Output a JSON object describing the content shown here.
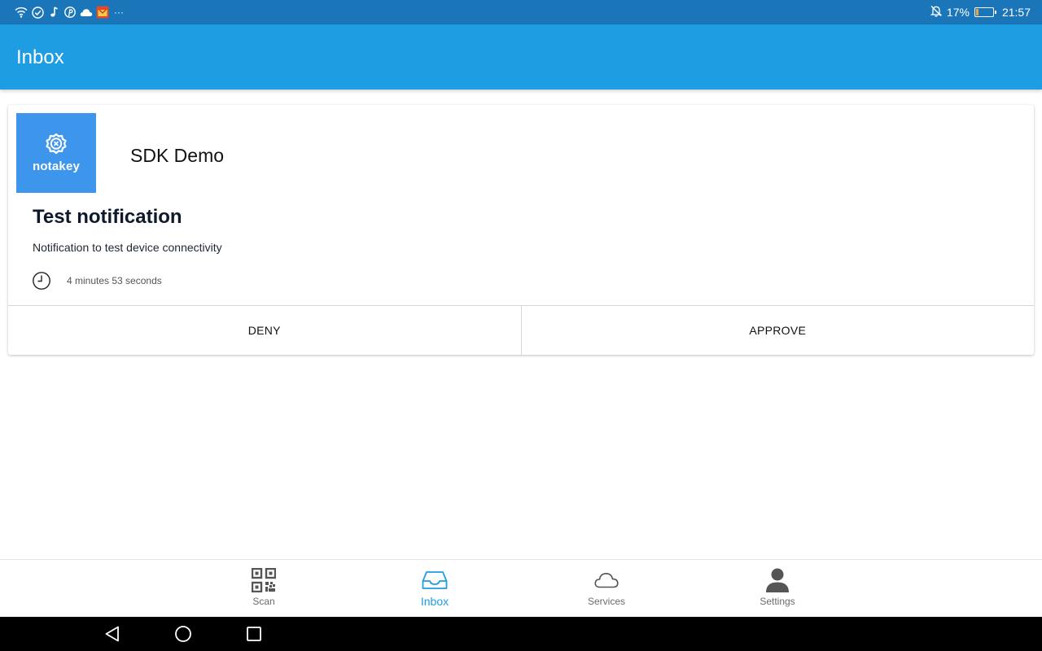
{
  "status_bar": {
    "left_icons": [
      "wifi-icon",
      "check-circle-icon",
      "music-note-icon",
      "pinterest-icon",
      "cloud-icon",
      "app-notification-icon",
      "more-dots-icon"
    ],
    "more_dots": "···",
    "right_icons": [
      "bell-off-icon",
      "battery-icon"
    ],
    "battery_percent": "17%",
    "battery_level": 0.17,
    "time": "21:57",
    "color": "#1a76b8"
  },
  "app_bar": {
    "title": "Inbox",
    "color": "#1f9de3"
  },
  "notification": {
    "logo_text": "notakey",
    "service_name": "SDK Demo",
    "title": "Test notification",
    "body": "Notification to test device connectivity",
    "elapsed": "4 minutes 53 seconds",
    "deny_label": "DENY",
    "approve_label": "APPROVE",
    "logo_color": "#3e96ec"
  },
  "bottom_nav": {
    "active": "Inbox",
    "accent_color": "#1f9de3",
    "items": [
      {
        "label": "Scan",
        "icon": "qr-code-icon"
      },
      {
        "label": "Inbox",
        "icon": "inbox-tray-icon"
      },
      {
        "label": "Services",
        "icon": "cloud-icon"
      },
      {
        "label": "Settings",
        "icon": "person-icon"
      }
    ]
  },
  "system_nav": {
    "buttons": [
      "back-triangle-icon",
      "home-circle-icon",
      "recents-square-icon"
    ]
  }
}
